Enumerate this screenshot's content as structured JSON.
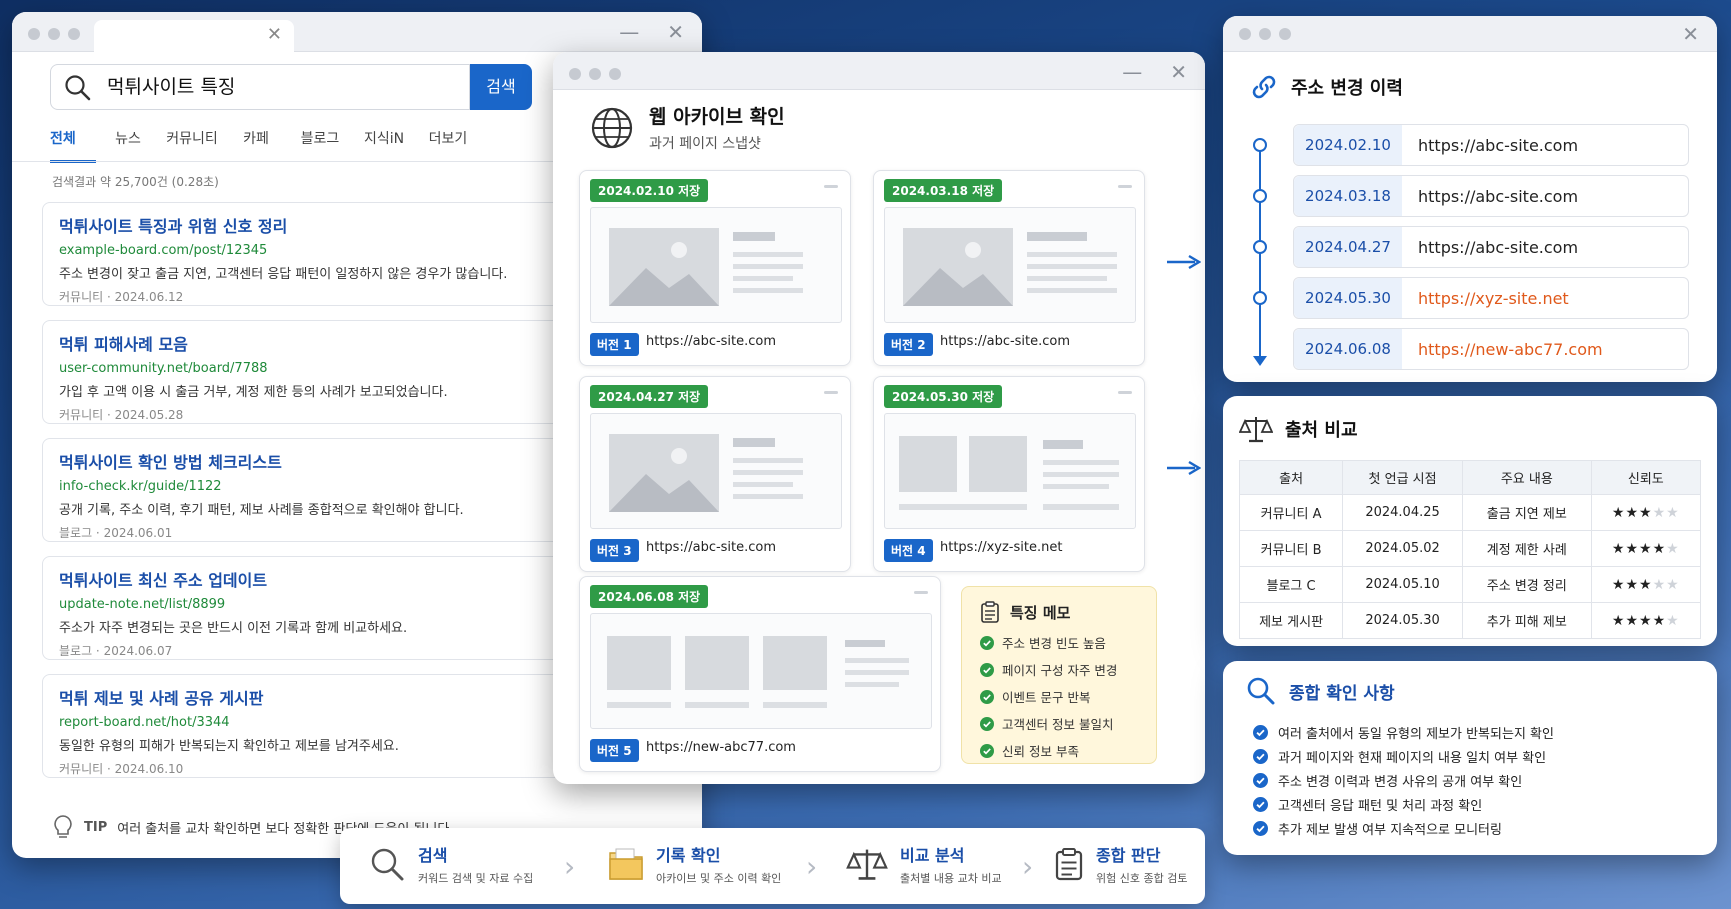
{
  "search_window": {
    "query": "먹튀사이트 특징",
    "search_button": "검색",
    "tabs": [
      "전체",
      "뉴스",
      "커뮤니티",
      "카페",
      "블로그",
      "지식iN",
      "더보기"
    ],
    "result_count": "검색결과 약 25,700건 (0.28초)",
    "results": [
      {
        "title": "먹튀사이트 특징과 위험 신호 정리",
        "url": "example-board.com/post/12345",
        "desc": "주소 변경이 잦고 출금 지연, 고객센터 응답 패턴이 일정하지 않은 경우가 많습니다.",
        "meta": "커뮤니티 · 2024.06.12"
      },
      {
        "title": "먹튀 피해사례 모음",
        "url": "user-community.net/board/7788",
        "desc": "가입 후 고액 이용 시 출금 거부, 계정 제한 등의 사례가 보고되었습니다.",
        "meta": "커뮤니티 · 2024.05.28"
      },
      {
        "title": "먹튀사이트 확인 방법 체크리스트",
        "url": "info-check.kr/guide/1122",
        "desc": "공개 기록, 주소 이력, 후기 패턴, 제보 사례를 종합적으로 확인해야 합니다.",
        "meta": "블로그 · 2024.06.01"
      },
      {
        "title": "먹튀사이트 최신 주소 업데이트",
        "url": "update-note.net/list/8899",
        "desc": "주소가 자주 변경되는 곳은 반드시 이전 기록과 함께 비교하세요.",
        "meta": "블로그 · 2024.06.07"
      },
      {
        "title": "먹튀 제보 및 사례 공유 게시판",
        "url": "report-board.net/hot/3344",
        "desc": "동일한 유형의 피해가 반복되는지 확인하고 제보를 남겨주세요.",
        "meta": "커뮤니티 · 2024.06.10"
      }
    ],
    "tip_label": "TIP",
    "tip_text": "여러 출처를 교차 확인하면 보다 정확한 판단에 도움이 됩니다."
  },
  "archive_window": {
    "title": "웹 아카이브 확인",
    "subtitle": "과거 페이지 스냅샷",
    "snapshots": [
      {
        "saved": "2024.02.10 저장",
        "version": "버전 1",
        "url": "https://abc-site.com"
      },
      {
        "saved": "2024.03.18 저장",
        "version": "버전 2",
        "url": "https://abc-site.com"
      },
      {
        "saved": "2024.04.27 저장",
        "version": "버전 3",
        "url": "https://abc-site.com"
      },
      {
        "saved": "2024.05.30 저장",
        "version": "버전 4",
        "url": "https://xyz-site.net"
      },
      {
        "saved": "2024.06.08 저장",
        "version": "버전 5",
        "url": "https://new-abc77.com"
      }
    ],
    "memo": {
      "title": "특징 메모",
      "items": [
        "주소 변경 빈도 높음",
        "페이지 구성 자주 변경",
        "이벤트 문구 반복",
        "고객센터 정보 불일치",
        "신뢰 정보 부족"
      ]
    }
  },
  "history_panel": {
    "title": "주소 변경 이력",
    "entries": [
      {
        "date": "2024.02.10",
        "url": "https://abc-site.com",
        "changed": false
      },
      {
        "date": "2024.03.18",
        "url": "https://abc-site.com",
        "changed": false
      },
      {
        "date": "2024.04.27",
        "url": "https://abc-site.com",
        "changed": false
      },
      {
        "date": "2024.05.30",
        "url": "https://xyz-site.net",
        "changed": true
      },
      {
        "date": "2024.06.08",
        "url": "https://new-abc77.com",
        "changed": true
      }
    ]
  },
  "compare_panel": {
    "title": "출처 비교",
    "headers": [
      "출처",
      "첫 언급 시점",
      "주요 내용",
      "신뢰도"
    ],
    "rows": [
      {
        "source": "커뮤니티 A",
        "first": "2024.04.25",
        "content": "출금 지연 제보",
        "rating": 3
      },
      {
        "source": "커뮤니티 B",
        "first": "2024.05.02",
        "content": "계정 제한 사례",
        "rating": 4
      },
      {
        "source": "블로그 C",
        "first": "2024.05.10",
        "content": "주소 변경 정리",
        "rating": 3
      },
      {
        "source": "제보 게시판",
        "first": "2024.05.30",
        "content": "추가 피해 제보",
        "rating": 4
      }
    ],
    "rating_max": 5
  },
  "summary_panel": {
    "title": "종합 확인 사항",
    "items": [
      "여러 출처에서 동일 유형의 제보가 반복되는지 확인",
      "과거 페이지와 현재 페이지의 내용 일치 여부 확인",
      "주소 변경 이력과 변경 사유의 공개 여부 확인",
      "고객센터 응답 패턴 및 처리 과정 확인",
      "추가 제보 발생 여부 지속적으로 모니터링"
    ]
  },
  "process_bar": {
    "steps": [
      {
        "title": "검색",
        "sub": "커워드 검색 및 자료 수집"
      },
      {
        "title": "기록 확인",
        "sub": "아카이브 및 주소 이력 확인"
      },
      {
        "title": "비교 분석",
        "sub": "출처별 내용 교차 비교"
      },
      {
        "title": "종합 판단",
        "sub": "위험 신호 종합 검토"
      }
    ]
  },
  "colors": {
    "accent_blue": "#1a66c9",
    "link_blue": "#1a4ea8",
    "url_green": "#1f8a3a",
    "saved_green": "#2f9b47",
    "changed_orange": "#e0591b",
    "star": "#f2a40b",
    "memo_bg": "#fff7dc"
  }
}
